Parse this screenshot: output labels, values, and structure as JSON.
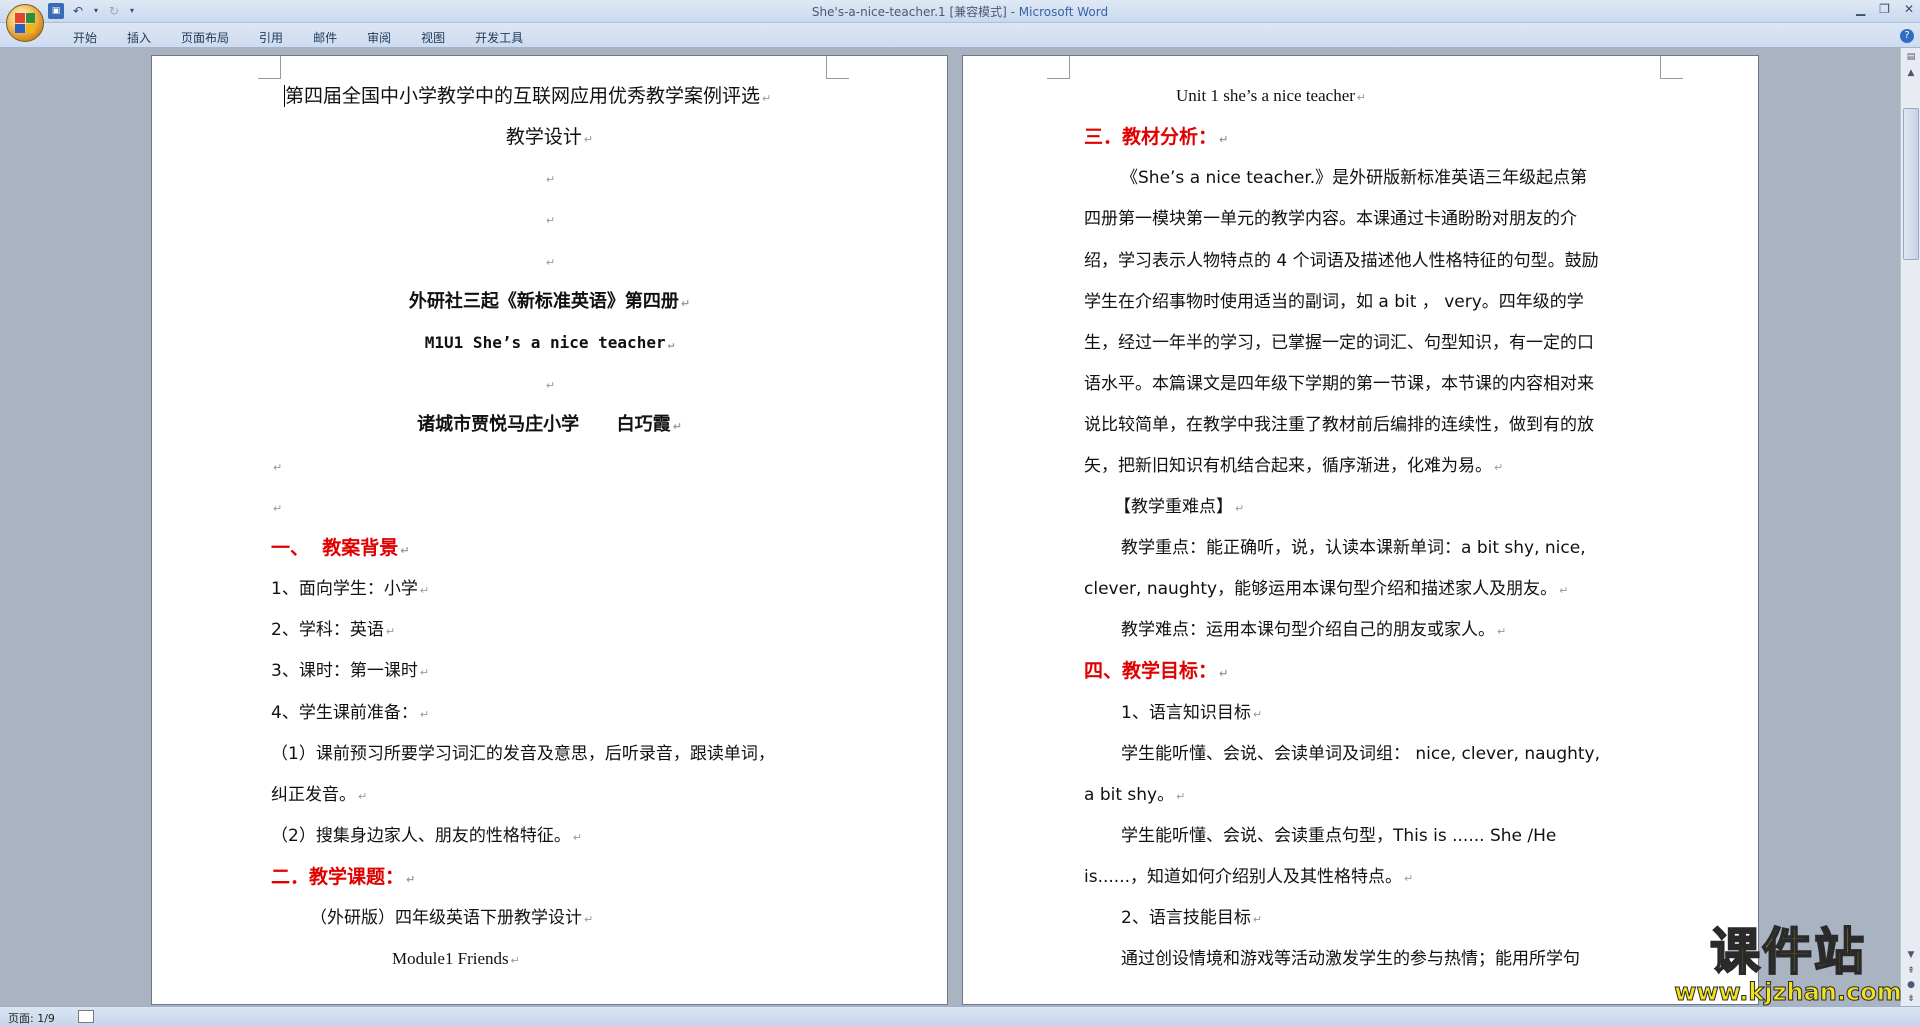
{
  "window": {
    "title": "She's-a-nice-teacher.1 [兼容模式] - ",
    "app": "Microsoft Word"
  },
  "ribbon": {
    "tabs": [
      "开始",
      "插入",
      "页面布局",
      "引用",
      "邮件",
      "审阅",
      "视图",
      "开发工具"
    ]
  },
  "page1": {
    "competition": "第四届全国中小学教学中的互联网应用优秀教学案例评选",
    "design": "教学设计",
    "textbook": "外研社三起《新标准英语》第四册",
    "lesson": "M1U1 She’s a nice teacher",
    "author": "诸城市贾悦马庄小学      白巧霞",
    "h1": "一、  教案背景",
    "item1": "1、面向学生：小学",
    "item2": "2、学科：英语",
    "item3": "3、课时：第一课时",
    "item4": "4、学生课前准备：",
    "prep1a": "（1）课前预习所要学习词汇的发音及意思，后听录音，跟读单词，",
    "prep1b": "纠正发音。",
    "prep2": "（2）搜集身边家人、朋友的性格特征。",
    "h2": "二．教学课题：",
    "topic": "（外研版）四年级英语下册教学设计",
    "module": "Module1 Friends"
  },
  "page2": {
    "unit": "Unit 1 she’s a nice teacher",
    "h3": "三．教材分析：",
    "p1": "《She’s a nice teacher.》是外研版新标准英语三年级起点第",
    "p2": "四册第一模块第一单元的教学内容。本课通过卡通盼盼对朋友的介",
    "p3": "绍，学习表示人物特点的 4 个词语及描述他人性格特征的句型。鼓励",
    "p4": "学生在介绍事物时使用适当的副词，如 a bit ， very。四年级的学",
    "p5": "生，经过一年半的学习，已掌握一定的词汇、句型知识，有一定的口",
    "p6": "语水平。本篇课文是四年级下学期的第一节课，本节课的内容相对来",
    "p7": "说比较简单，在教学中我注重了教材前后编排的连续性，做到有的放",
    "p8": "矢，把新旧知识有机结合起来，循序渐进，化难为易。",
    "keypoints": "【教学重难点】",
    "focus1": "教学重点：能正确听，说，认读本课新单词：a bit shy, nice,",
    "focus2": "clever, naughty，能够运用本课句型介绍和描述家人及朋友。",
    "difficult": "教学难点：运用本课句型介绍自己的朋友或家人。",
    "h4": "四、教学目标：",
    "goal1": "1、语言知识目标",
    "g1a": "学生能听懂、会说、会读单词及词组： nice, clever, naughty,",
    "g1b": "a bit shy。",
    "g2a": "学生能听懂、会说、会读重点句型，This is ...... She /He",
    "g2b": "is......，知道如何介绍别人及其性格特点。",
    "goal2": "2、语言技能目标",
    "g3": "通过创设情境和游戏等活动激发学生的参与热情；能用所学句"
  },
  "paragraph_mark": "↵",
  "status": {
    "page": "页面: 1/9"
  },
  "watermark": {
    "title": "课件站",
    "url": "www.kjzhan.com"
  }
}
